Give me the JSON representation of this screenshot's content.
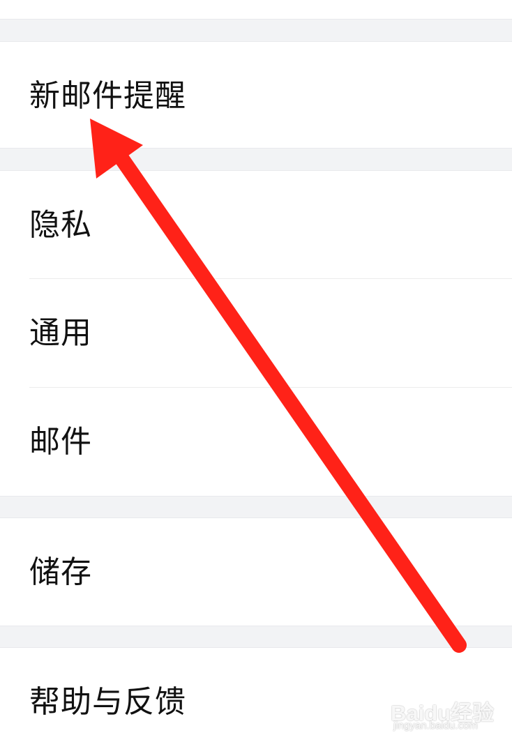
{
  "settings": {
    "items": [
      {
        "label": "新邮件提醒"
      },
      {
        "label": "隐私"
      },
      {
        "label": "通用"
      },
      {
        "label": "邮件"
      },
      {
        "label": "储存"
      },
      {
        "label": "帮助与反馈"
      }
    ]
  },
  "annotation": {
    "color": "#ff2218"
  },
  "watermark": {
    "main": "Baidu经验",
    "sub": "jingyan.baidu.com"
  }
}
